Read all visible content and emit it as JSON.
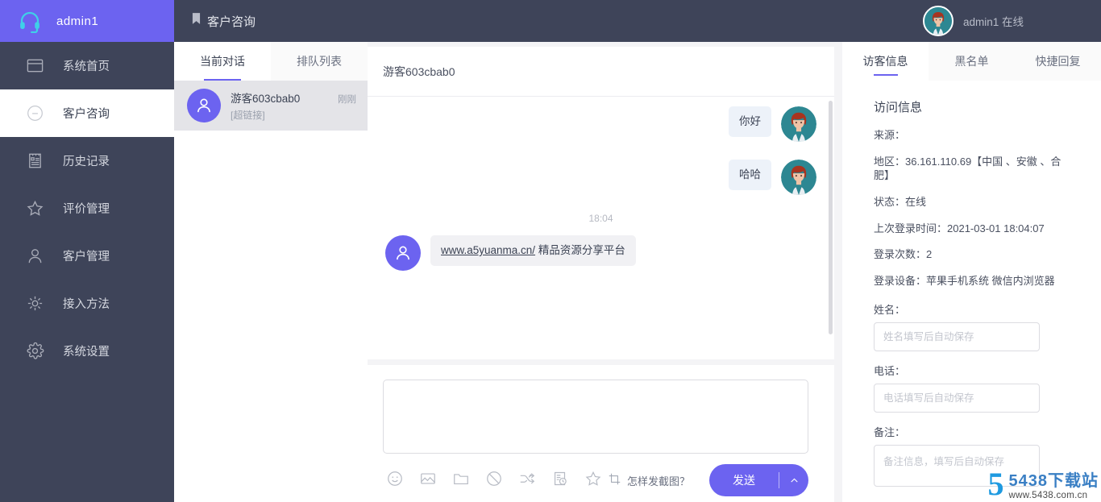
{
  "colors": {
    "brand_purple": "#6c63f0",
    "sidebar_dark": "#3e4459",
    "panel_white": "#ffffff",
    "page_bg": "#f4f4f6",
    "active_conv_bg": "#e4e4e8",
    "bubble_out": "#edf2f9",
    "bubble_in": "#f1f1f4"
  },
  "sidebar": {
    "logo_label": "admin1",
    "logo_icon": "headset-icon",
    "items": [
      {
        "label": "系统首页",
        "icon": "window-icon",
        "active": false
      },
      {
        "label": "客户咨询",
        "icon": "chat-circle-icon",
        "active": true
      },
      {
        "label": "历史记录",
        "icon": "notebook-icon",
        "active": false
      },
      {
        "label": "评价管理",
        "icon": "star-icon",
        "active": false
      },
      {
        "label": "客户管理",
        "icon": "user-icon",
        "active": false
      },
      {
        "label": "接入方法",
        "icon": "connect-icon",
        "active": false
      },
      {
        "label": "系统设置",
        "icon": "gear-icon",
        "active": false
      }
    ]
  },
  "topbar": {
    "icon": "bookmark-icon",
    "title": "客户咨询",
    "user_label": "admin1 在线",
    "avatar_icon": "agent-avatar"
  },
  "conversation_panel": {
    "tabs": [
      {
        "label": "当前对话",
        "active": true
      },
      {
        "label": "排队列表",
        "active": false
      }
    ],
    "items": [
      {
        "name": "游客603cbab0",
        "time": "刚刚",
        "snippet": "[超链接]",
        "avatar_icon": "visitor-avatar",
        "active": true
      }
    ]
  },
  "chat": {
    "header_name": "游客603cbab0",
    "messages": [
      {
        "side": "out",
        "type": "text",
        "text": "你好",
        "avatar_icon": "agent-avatar"
      },
      {
        "side": "out",
        "type": "text",
        "text": "哈哈",
        "avatar_icon": "agent-avatar"
      },
      {
        "side": "divider",
        "type": "time",
        "text": "18:04"
      },
      {
        "side": "in",
        "type": "link",
        "link_text": "www.a5yuanma.cn/",
        "text": " 精品资源分享平台",
        "avatar_icon": "visitor-avatar"
      }
    ]
  },
  "composer": {
    "input_value": "",
    "input_placeholder": "",
    "tool_icons": [
      "emoji-icon",
      "image-icon",
      "folder-icon",
      "ban-icon",
      "transfer-icon",
      "history-icon",
      "star-icon"
    ],
    "snip_hint_icon": "crop-icon",
    "snip_hint_label": "怎样发截图？",
    "send_label": "发送",
    "send_caret_icon": "chevron-up-icon"
  },
  "info_panel": {
    "tabs": [
      {
        "label": "访客信息",
        "active": true
      },
      {
        "label": "黑名单",
        "active": false
      },
      {
        "label": "快捷回复",
        "active": false
      }
    ],
    "section_title": "访问信息",
    "lines": [
      "来源：",
      "地区：36.161.110.69【中国 、安徽 、合肥】",
      "状态：在线",
      "上次登录时间：2021-03-01 18:04:07",
      "登录次数：2",
      "登录设备：苹果手机系统 微信内浏览器"
    ],
    "fields": [
      {
        "label": "姓名：",
        "value": "",
        "placeholder": "姓名填写后自动保存",
        "type": "input"
      },
      {
        "label": "电话：",
        "value": "",
        "placeholder": "电话填写后自动保存",
        "type": "input"
      },
      {
        "label": "备注：",
        "value": "",
        "placeholder": "备注信息，填写后自动保存",
        "type": "textarea"
      }
    ]
  },
  "watermark": {
    "mark": "5",
    "top": "5438下载站",
    "bottom": "www.5438.com.cn"
  }
}
